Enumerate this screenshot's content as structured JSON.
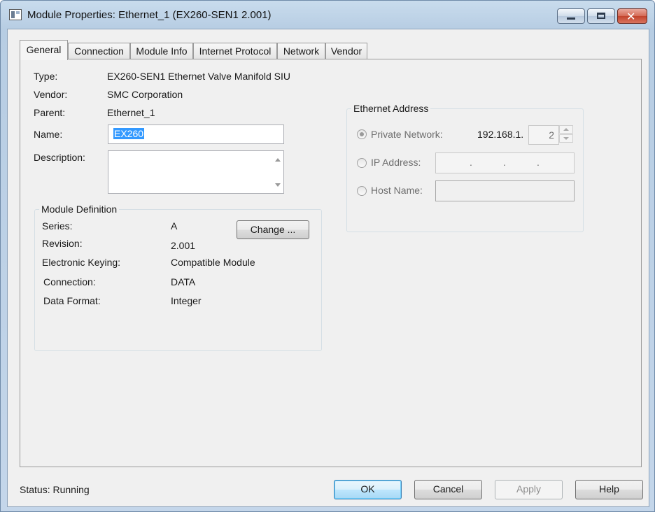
{
  "window": {
    "title": "Module Properties: Ethernet_1 (EX260-SEN1 2.001)"
  },
  "tabs": [
    {
      "label": "General"
    },
    {
      "label": "Connection"
    },
    {
      "label": "Module Info"
    },
    {
      "label": "Internet Protocol"
    },
    {
      "label": "Network"
    },
    {
      "label": "Vendor"
    }
  ],
  "general": {
    "type_label": "Type:",
    "type_value": "EX260-SEN1 Ethernet Valve Manifold SIU",
    "vendor_label": "Vendor:",
    "vendor_value": "SMC Corporation",
    "parent_label": "Parent:",
    "parent_value": "Ethernet_1",
    "name_label": "Name:",
    "name_value": "EX260",
    "description_label": "Description:",
    "description_value": ""
  },
  "module_definition": {
    "title": "Module Definition",
    "series_label": "Series:",
    "series_value": "A",
    "revision_label": "Revision:",
    "revision_value": "2.001",
    "keying_label": "Electronic Keying:",
    "keying_value": "Compatible Module",
    "connection_label": "Connection:",
    "connection_value": "DATA",
    "data_format_label": "Data Format:",
    "data_format_value": "Integer",
    "change_button": "Change ..."
  },
  "ethernet_address": {
    "title": "Ethernet Address",
    "private_network_label": "Private Network:",
    "private_network_prefix": "192.168.1.",
    "private_network_value": "2",
    "ip_address_label": "IP Address:",
    "ip_dots": [
      ".",
      ".",
      "."
    ],
    "host_name_label": "Host Name:",
    "selected_option": "Private Network"
  },
  "footer": {
    "status_label": "Status:",
    "status_value": "Running",
    "ok_button": "OK",
    "cancel_button": "Cancel",
    "apply_button": "Apply",
    "help_button": "Help"
  }
}
